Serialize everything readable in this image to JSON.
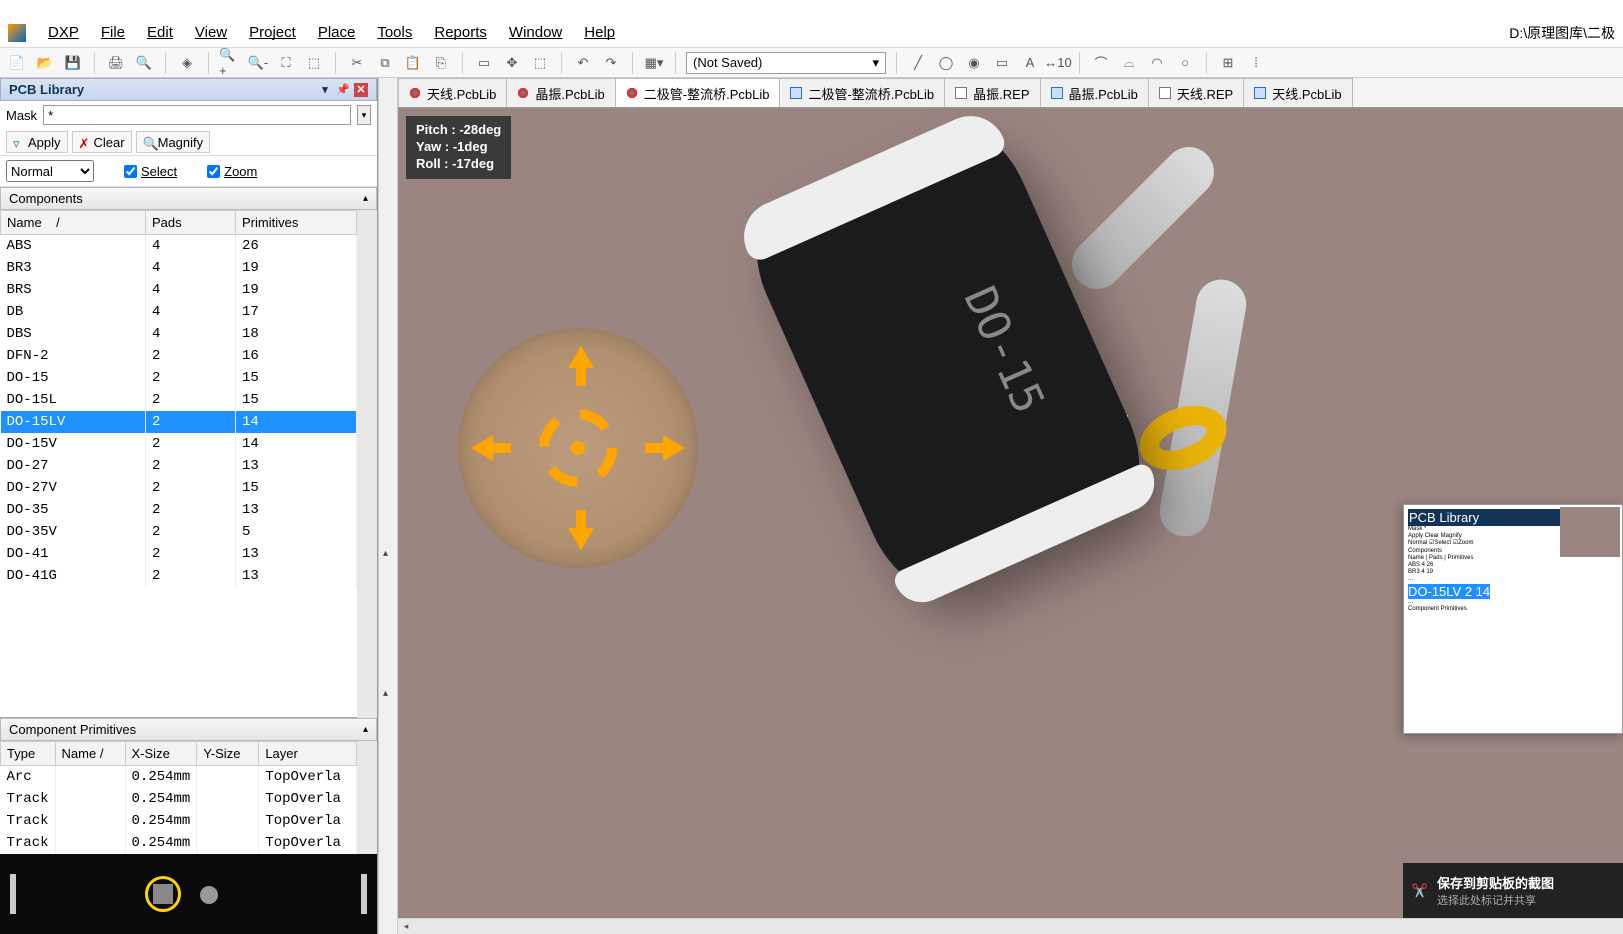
{
  "path": "D:\\原理图库\\二极",
  "menu": {
    "dxp": "DXP",
    "file": "File",
    "edit": "Edit",
    "view": "View",
    "project": "Project",
    "place": "Place",
    "tools": "Tools",
    "reports": "Reports",
    "window": "Window",
    "help": "Help"
  },
  "toolbar_dropdown": "(Not Saved)",
  "sidebar": {
    "title": "PCB Library",
    "mask_label": "Mask",
    "mask_value": "*",
    "apply": "Apply",
    "clear": "Clear",
    "magnify": "Magnify",
    "normal": "Normal",
    "select": "Select",
    "zoom": "Zoom"
  },
  "components_header": "Components",
  "components_cols": {
    "name": "Name",
    "pads": "Pads",
    "primitives": "Primitives"
  },
  "components": [
    {
      "name": "ABS",
      "pads": "4",
      "primitives": "26"
    },
    {
      "name": "BR3",
      "pads": "4",
      "primitives": "19"
    },
    {
      "name": "BRS",
      "pads": "4",
      "primitives": "19"
    },
    {
      "name": "DB",
      "pads": "4",
      "primitives": "17"
    },
    {
      "name": "DBS",
      "pads": "4",
      "primitives": "18"
    },
    {
      "name": "DFN-2",
      "pads": "2",
      "primitives": "16"
    },
    {
      "name": "DO-15",
      "pads": "2",
      "primitives": "15"
    },
    {
      "name": "DO-15L",
      "pads": "2",
      "primitives": "15"
    },
    {
      "name": "DO-15LV",
      "pads": "2",
      "primitives": "14",
      "sel": true
    },
    {
      "name": "DO-15V",
      "pads": "2",
      "primitives": "14"
    },
    {
      "name": "DO-27",
      "pads": "2",
      "primitives": "13"
    },
    {
      "name": "DO-27V",
      "pads": "2",
      "primitives": "15"
    },
    {
      "name": "DO-35",
      "pads": "2",
      "primitives": "13"
    },
    {
      "name": "DO-35V",
      "pads": "2",
      "primitives": "5"
    },
    {
      "name": "DO-41",
      "pads": "2",
      "primitives": "13"
    },
    {
      "name": "DO-41G",
      "pads": "2",
      "primitives": "13"
    }
  ],
  "primitives_header": "Component Primitives",
  "primitives_cols": {
    "type": "Type",
    "name": "Name",
    "xsize": "X-Size",
    "ysize": "Y-Size",
    "layer": "Layer"
  },
  "primitives": [
    {
      "type": "Arc",
      "name": "",
      "xsize": "0.254mm",
      "ysize": "",
      "layer": "TopOverla"
    },
    {
      "type": "Track",
      "name": "",
      "xsize": "0.254mm",
      "ysize": "",
      "layer": "TopOverla"
    },
    {
      "type": "Track",
      "name": "",
      "xsize": "0.254mm",
      "ysize": "",
      "layer": "TopOverla"
    },
    {
      "type": "Track",
      "name": "",
      "xsize": "0.254mm",
      "ysize": "",
      "layer": "TopOverla"
    }
  ],
  "tabs": [
    {
      "label": "天线.PcbLib",
      "icon": "red"
    },
    {
      "label": "晶振.PcbLib",
      "icon": "red"
    },
    {
      "label": "二极管-整流桥.PcbLib",
      "icon": "red",
      "active": true
    },
    {
      "label": "二极管-整流桥.PcbLib",
      "icon": "blue"
    },
    {
      "label": "晶振.REP",
      "icon": "doc"
    },
    {
      "label": "晶振.PcbLib",
      "icon": "blue"
    },
    {
      "label": "天线.REP",
      "icon": "doc"
    },
    {
      "label": "天线.PcbLib",
      "icon": "blue"
    }
  ],
  "hud": {
    "pitch": "Pitch : -28deg",
    "yaw": "Yaw : -1deg",
    "roll": "Roll : -17deg"
  },
  "model_text": "DO-15",
  "snip": {
    "title": "保存到剪贴板的截图",
    "sub": "选择此处标记并共享"
  }
}
